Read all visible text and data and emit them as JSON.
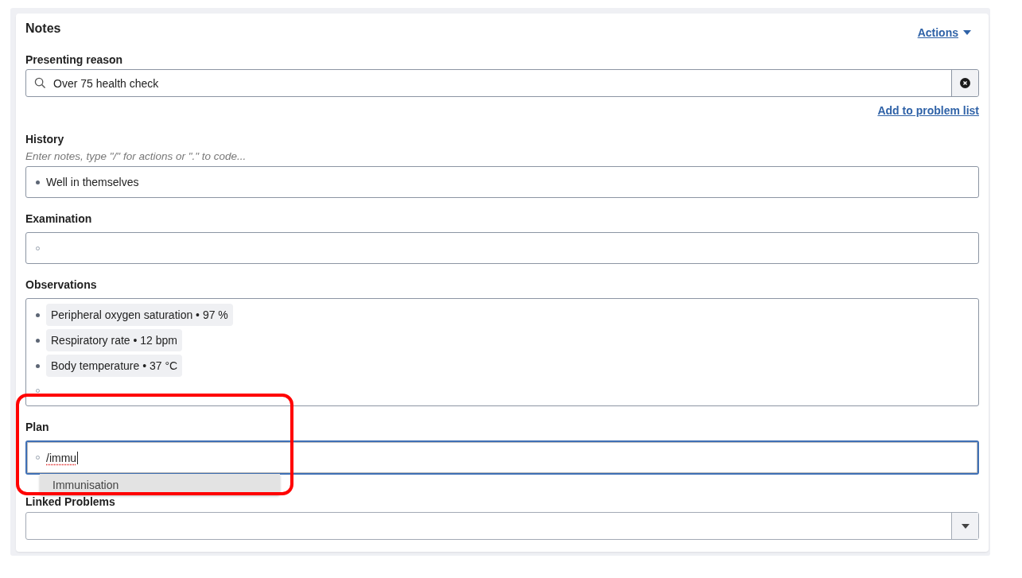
{
  "card": {
    "title": "Notes",
    "actions": "Actions"
  },
  "sections": [
    {
      "kind": "search",
      "label": "Presenting reason",
      "value": "Over 75 health check",
      "link": "Add to problem list"
    },
    {
      "kind": "notes",
      "label": "History",
      "hint": "Enter notes, type \"/\" for actions or \".\" to code...",
      "focused": false,
      "lines": [
        {
          "kind": "text",
          "filled": true,
          "text": "Well in themselves"
        }
      ]
    },
    {
      "kind": "notes",
      "label": "Examination",
      "focused": false,
      "lines": [
        {
          "kind": "blank",
          "filled": false
        }
      ]
    },
    {
      "kind": "notes",
      "label": "Observations",
      "focused": false,
      "lines": [
        {
          "kind": "chip",
          "filled": true,
          "text": "Peripheral oxygen saturation • 97 %"
        },
        {
          "kind": "chip",
          "filled": true,
          "text": "Respiratory rate • 12 bpm"
        },
        {
          "kind": "chip",
          "filled": true,
          "text": "Body temperature • 37 °C"
        },
        {
          "kind": "blank",
          "filled": false
        }
      ]
    },
    {
      "kind": "notes",
      "label": "Plan",
      "focused": true,
      "highlighted": true,
      "lines": [
        {
          "kind": "typing",
          "filled": false,
          "text": "/immu"
        }
      ],
      "suggestions": [
        {
          "label": "Immunisation",
          "selected": true
        }
      ]
    },
    {
      "kind": "select",
      "label": "Linked Problems"
    }
  ]
}
